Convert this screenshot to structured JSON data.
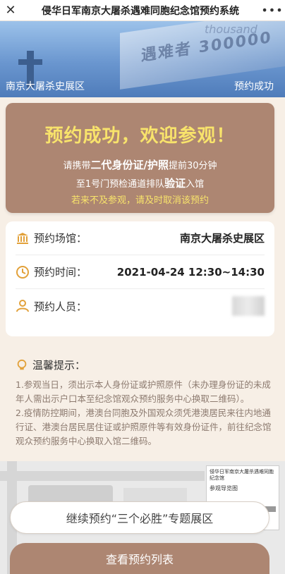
{
  "topbar": {
    "close_icon": "close-icon",
    "title": "侵华日军南京大屠杀遇难同胞纪念馆预约系统",
    "more_icon": "more-icon"
  },
  "banner": {
    "left_label": "南京大屠杀史展区",
    "right_label": "预约成功",
    "number_text": "遇难者 300000",
    "word_text": "thousand"
  },
  "success": {
    "headline": "预约成功，欢迎参观！",
    "line1_pre": "请携带",
    "line1_bold": "二代身份证/护照",
    "line1_post": "提前30分钟",
    "line2_pre": "至1号门预检通道排队",
    "line2_bold": "验证",
    "line2_post": "入馆",
    "line3": "若来不及参观，请及时取消该预约"
  },
  "info": {
    "rows": [
      {
        "icon": "museum-icon",
        "label": "预约场馆：",
        "value": "南京大屠杀史展区"
      },
      {
        "icon": "clock-icon",
        "label": "预约时间：",
        "value": "2021-04-24 12:30~14:30"
      },
      {
        "icon": "person-icon",
        "label": "预约人员：",
        "value": ""
      }
    ]
  },
  "tips": {
    "title": "温馨提示：",
    "icon": "lightbulb-icon",
    "items": [
      "1.参观当日，须出示本人身份证或护照原件（未办理身份证的未成年人需出示户口本至纪念馆观众预约服务中心换取二维码）。",
      "2.疫情防控期间，港澳台同胞及外国观众须凭港澳居民来往内地通行证、港澳台居民居住证或护照原件等有效身份证件，前往纪念馆观众预约服务中心换取入馆二维码。"
    ]
  },
  "map": {
    "legend_title": "侵华日军南京大屠杀遇难同胞纪念馆",
    "legend_sub": "参观导览图"
  },
  "buttons": {
    "continue": "继续预约“三个必胜”专题展区",
    "list": "查看预约列表"
  },
  "colors": {
    "accent": "#ad8672",
    "highlight": "#f8e36b",
    "icon": "#e2a13a"
  }
}
